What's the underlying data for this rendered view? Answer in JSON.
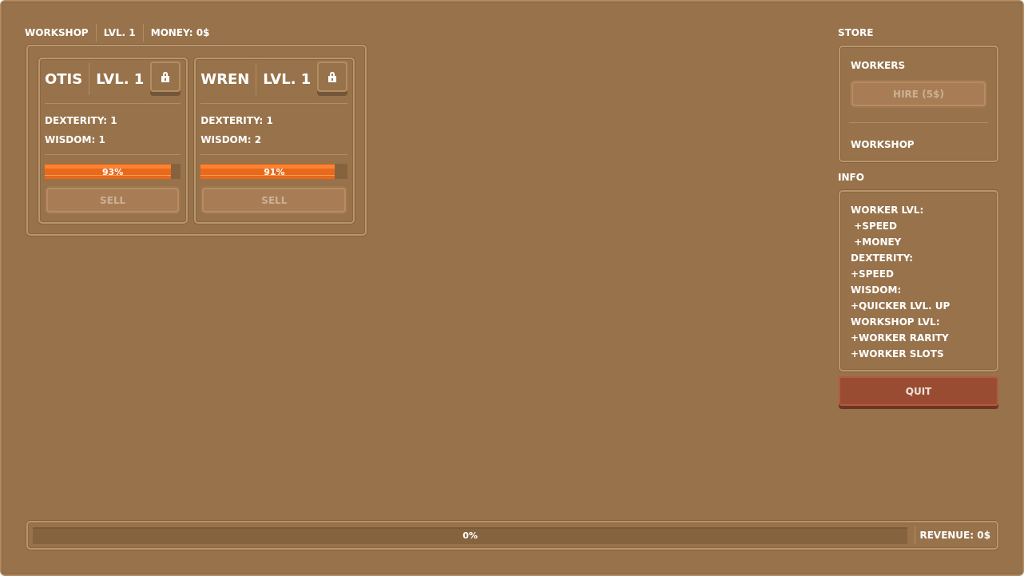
{
  "header": {
    "items": [
      "WORKSHOP",
      "LVL. 1",
      "MONEY: 0$"
    ]
  },
  "workshop": {
    "workers": [
      {
        "name": "OTIS",
        "level": "LVL. 1",
        "stats": [
          "DEXTERITY: 1",
          "WISDOM: 1"
        ],
        "progress": {
          "level": 0.93,
          "reading": "93%"
        },
        "sell": {
          "label": "SELL",
          "disabled": true
        }
      },
      {
        "name": "WREN",
        "level": "LVL. 1",
        "stats": [
          "DEXTERITY: 1",
          "WISDOM: 2"
        ],
        "progress": {
          "level": 0.91,
          "reading": "91%"
        },
        "sell": {
          "label": "SELL",
          "disabled": true
        }
      }
    ]
  },
  "store": {
    "title": "STORE",
    "sections": [
      {
        "title": "WORKERS",
        "button": {
          "label": "HIRE (5$)",
          "disabled": true
        }
      },
      {
        "title": "WORKSHOP"
      }
    ]
  },
  "info": {
    "title": "INFO",
    "lines": [
      "WORKER LVL:",
      " +SPEED",
      " +MONEY",
      "DEXTERITY:",
      "+SPEED",
      "WISDOM:",
      "+QUICKER LVL. UP",
      "WORKSHOP LVL:",
      "+WORKER RARITY",
      "+WORKER SLOTS"
    ]
  },
  "quit": {
    "label": "QUIT"
  },
  "footer": {
    "progress": {
      "reading": "0%"
    },
    "revenue": "REVENUE: 0$"
  }
}
